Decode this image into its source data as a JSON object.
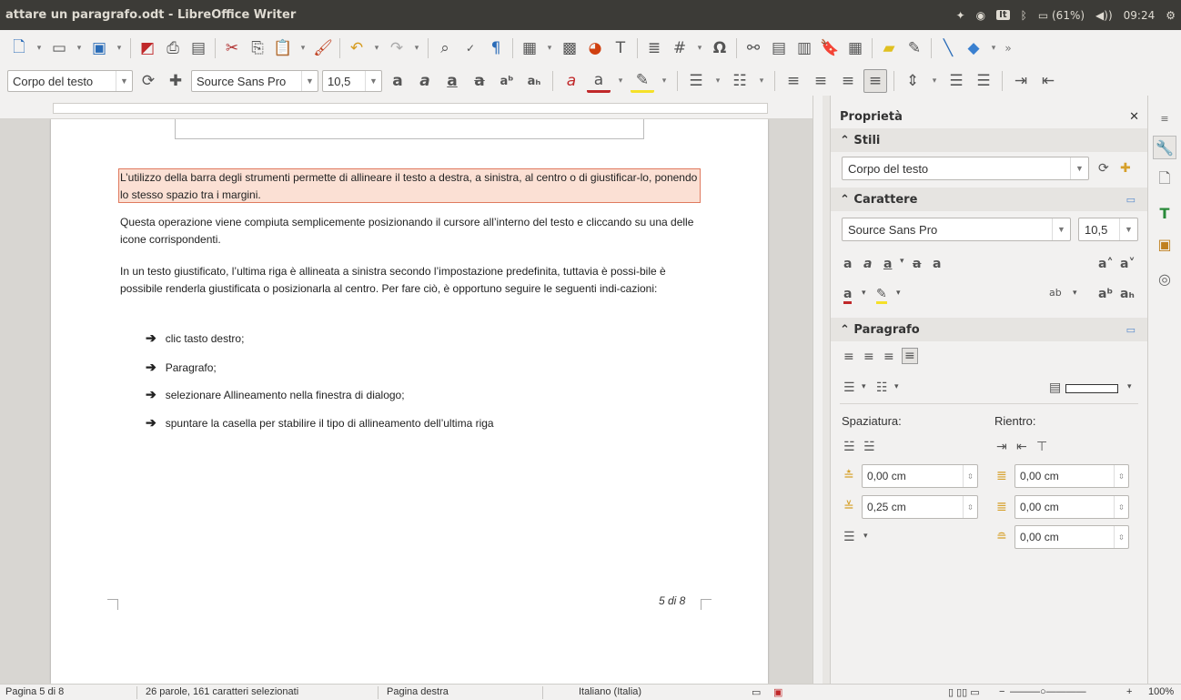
{
  "window": {
    "title": "attare un paragrafo.odt - LibreOffice Writer"
  },
  "indicators": {
    "lang": "It",
    "battery": "(61%)",
    "clock": "09:24"
  },
  "toolbar2": {
    "style": "Corpo del testo",
    "font": "Source Sans Pro",
    "size": "10,5"
  },
  "document": {
    "para1": "L’utilizzo della barra degli strumenti permette di allineare il testo a destra, a sinistra, al centro o di giustificar-lo, ponendo lo stesso spazio tra i margini.",
    "para2": "Questa operazione viene compiuta semplicemente posizionando il cursore all’interno del testo e cliccando su una delle icone corrispondenti.",
    "para3": "In un testo giustificato, l’ultima riga è allineata a sinistra secondo l’impostazione predefinita, tuttavia è possi-bile è possibile renderla giustificata o posizionarla al centro. Per fare ciò, è opportuno seguire le seguenti indi-cazioni:",
    "bullets": [
      "clic tasto destro;",
      "Paragrafo;",
      "selezionare Allineamento nella finestra di dialogo;",
      "spuntare la casella per stabilire il tipo di allineamento dell’ultima riga"
    ],
    "page_number": "5 di 8"
  },
  "sidebar": {
    "title": "Proprietà",
    "styles_header": "Stili",
    "style_value": "Corpo del testo",
    "character_header": "Carattere",
    "font_value": "Source Sans Pro",
    "size_value": "10,5",
    "paragraph_header": "Paragrafo",
    "spacing_label": "Spaziatura:",
    "indent_label": "Rientro:",
    "above": "0,00 cm",
    "below": "0,25 cm",
    "indent_before": "0,00 cm",
    "indent_after": "0,00 cm",
    "first_line": "0,00 cm"
  },
  "status": {
    "page": "Pagina 5 di 8",
    "words": "26 parole, 161 caratteri selezionati",
    "pagestyle": "Pagina destra",
    "language": "Italiano (Italia)",
    "zoom": "100%"
  },
  "colors": {
    "titlebar": "#3c3b37",
    "selection": "#fbe0d4",
    "selection_border": "#e07a5f"
  }
}
